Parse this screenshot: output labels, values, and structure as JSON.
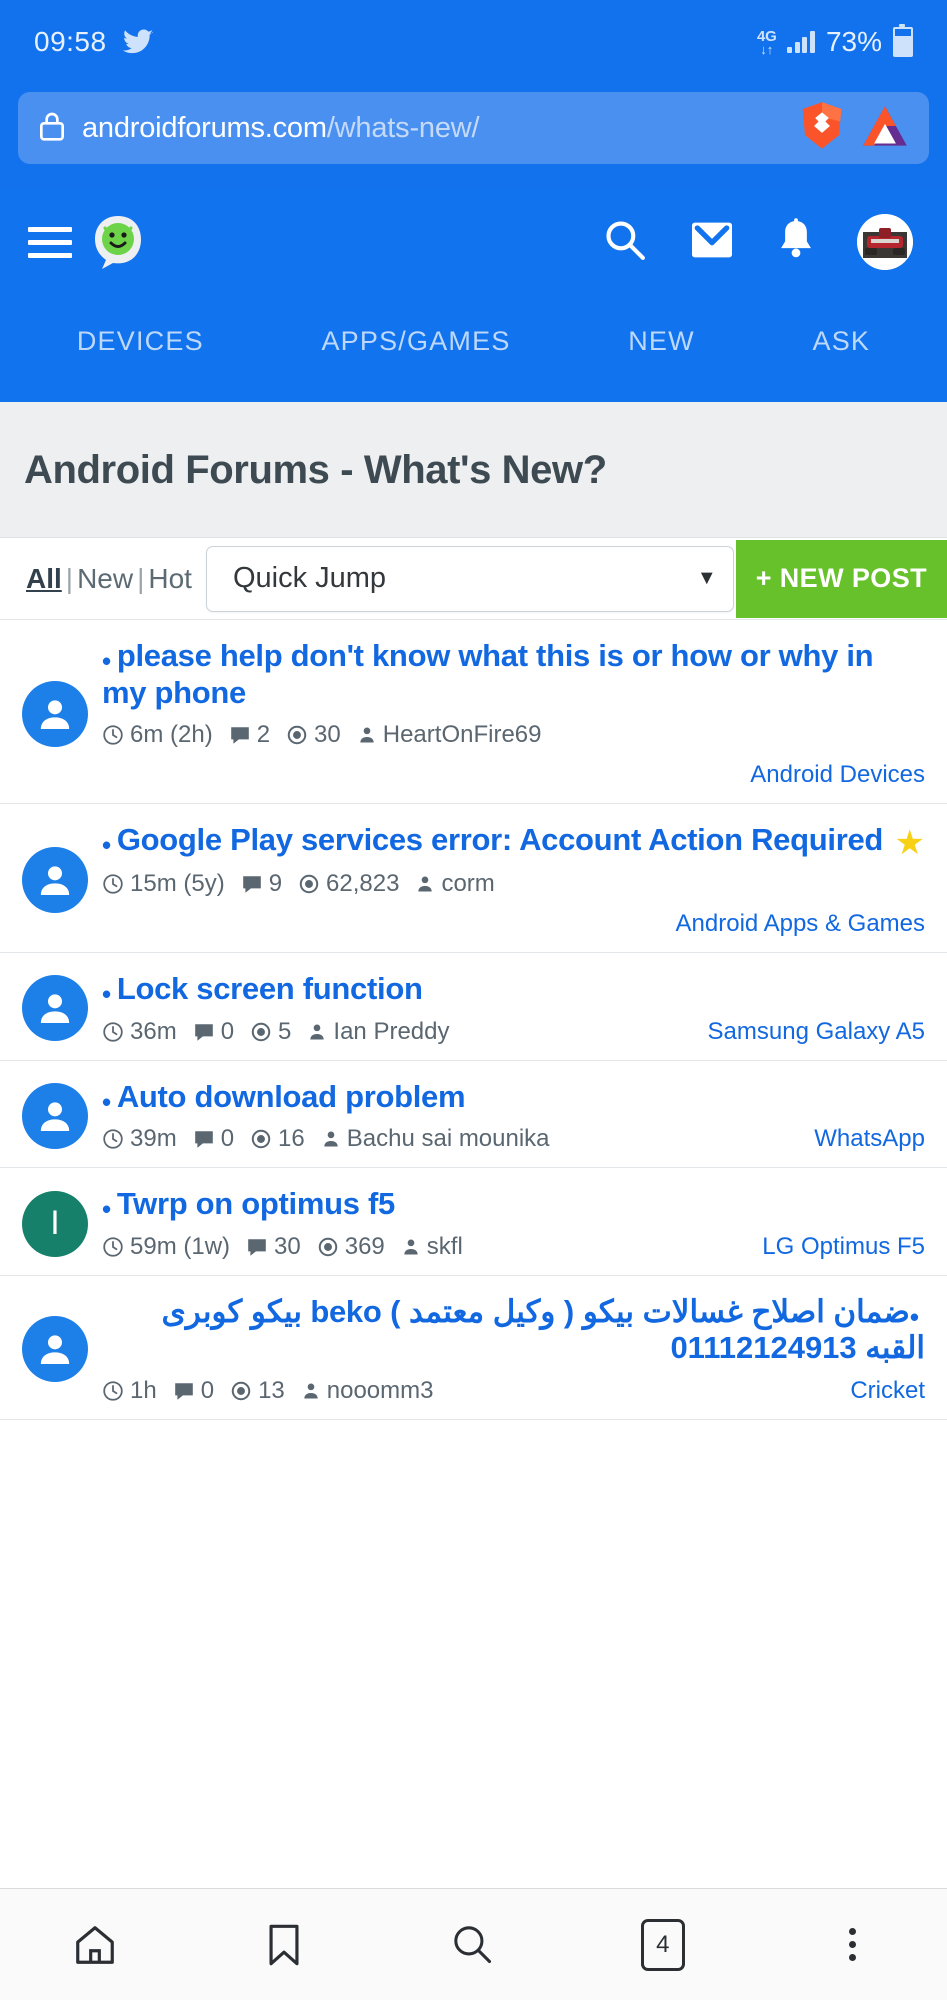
{
  "status_bar": {
    "time": "09:58",
    "twitter_icon": "twitter-bird-icon",
    "network_type": "4G",
    "data_arrows": "↓↑",
    "battery_percent": "73%"
  },
  "browser": {
    "url_domain": "androidforums.com",
    "url_path": "/whats-new/",
    "lock_icon": "lock-icon",
    "brave_icon": "brave-lion-icon",
    "bat_icon": "bat-triangle-icon"
  },
  "site_header": {
    "menu_icon": "hamburger-menu-icon",
    "logo_icon": "android-forums-logo",
    "actions": [
      {
        "name": "search-icon",
        "label": "Search"
      },
      {
        "name": "inbox-icon",
        "label": "Inbox"
      },
      {
        "name": "bell-icon",
        "label": "Alerts"
      },
      {
        "name": "avatar",
        "label": "Account"
      }
    ],
    "tabs": [
      {
        "label": "DEVICES"
      },
      {
        "label": "APPS/GAMES"
      },
      {
        "label": "NEW"
      },
      {
        "label": "ASK"
      }
    ]
  },
  "page": {
    "title": "Android Forums - What's New?"
  },
  "filter_bar": {
    "all_label": "All",
    "new_label": "New",
    "hot_label": "Hot",
    "separator": "|",
    "quick_jump_value": "Quick Jump",
    "quick_jump_caret": "▼",
    "new_post_label": "+ NEW POST"
  },
  "threads": [
    {
      "title": "please help don't know what this is or how or why in my phone",
      "rtl": false,
      "starred": false,
      "avatar_type": "person",
      "avatar_letter": "",
      "time": "6m (2h)",
      "replies": "2",
      "views": "30",
      "author": "HeartOnFire69",
      "forum": "Android Devices",
      "forum_below": true
    },
    {
      "title": "Google Play services error: Account Action Required",
      "rtl": false,
      "starred": true,
      "avatar_type": "person",
      "avatar_letter": "",
      "time": "15m (5y)",
      "replies": "9",
      "views": "62,823",
      "author": "corm",
      "forum": "Android Apps & Games",
      "forum_below": true
    },
    {
      "title": "Lock screen function",
      "rtl": false,
      "starred": false,
      "avatar_type": "person",
      "avatar_letter": "",
      "time": "36m",
      "replies": "0",
      "views": "5",
      "author": "Ian Preddy",
      "forum": "Samsung Galaxy A5",
      "forum_below": false
    },
    {
      "title": "Auto download problem",
      "rtl": false,
      "starred": false,
      "avatar_type": "person",
      "avatar_letter": "",
      "time": "39m",
      "replies": "0",
      "views": "16",
      "author": "Bachu sai mounika",
      "forum": "WhatsApp",
      "forum_below": false
    },
    {
      "title": "Twrp on optimus f5",
      "rtl": false,
      "starred": false,
      "avatar_type": "letter",
      "avatar_letter": "I",
      "time": "59m (1w)",
      "replies": "30",
      "views": "369",
      "author": "skfl",
      "forum": "LG Optimus F5",
      "forum_below": false
    },
    {
      "title": "ضمان اصلاح غسالات بيكو ( وكيل معتمد ) beko بيكو كوبرى القبه 01112124913",
      "rtl": true,
      "starred": false,
      "avatar_type": "person",
      "avatar_letter": "",
      "time": "1h",
      "replies": "0",
      "views": "13",
      "author": "nooomm3",
      "forum": "Cricket",
      "forum_below": false
    }
  ],
  "bottom_nav": [
    {
      "name": "home-icon",
      "label": "Home"
    },
    {
      "name": "bookmark-icon",
      "label": "Bookmarks"
    },
    {
      "name": "search-icon",
      "label": "Search"
    },
    {
      "name": "tab-count-icon",
      "label": "4"
    },
    {
      "name": "more-menu-icon",
      "label": "More"
    }
  ],
  "colors": {
    "header_blue": "#1272EE",
    "urlbar_blue": "#4A90F0",
    "link_blue": "#1268E0",
    "new_post_green": "#66C12A",
    "star_yellow": "#F8D117",
    "avatar_teal": "#17806B",
    "title_gray": "#3E4A52"
  }
}
